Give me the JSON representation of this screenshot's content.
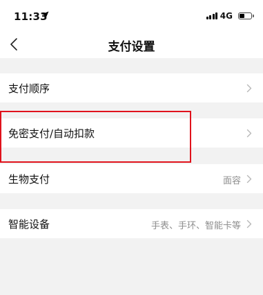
{
  "status_bar": {
    "time": "11:33",
    "network": "4G",
    "icons": [
      "location-arrow-icon",
      "signal-icon",
      "battery-icon"
    ]
  },
  "nav": {
    "title": "支付设置",
    "back_icon": "chevron-left-icon"
  },
  "settings": {
    "items": [
      {
        "label": "支付顺序",
        "value": ""
      },
      {
        "label": "免密支付/自动扣款",
        "value": ""
      },
      {
        "label": "生物支付",
        "value": "面容"
      },
      {
        "label": "智能设备",
        "value": "手表、手环、智能卡等"
      }
    ]
  },
  "colors": {
    "background": "#f2f2f2",
    "row_background": "#ffffff",
    "highlight": "#e0121c",
    "secondary_text": "#8e8e8e"
  }
}
